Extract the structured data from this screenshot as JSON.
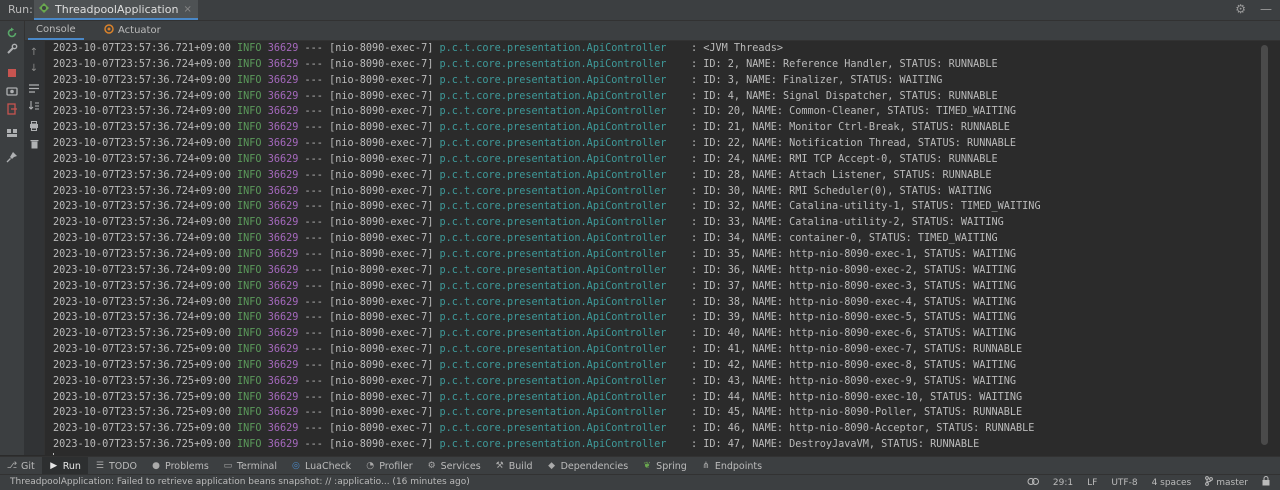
{
  "run_bar": {
    "label": "Run:",
    "tab": "ThreadpoolApplication",
    "close": "×"
  },
  "sub_tabs": {
    "console": "Console",
    "actuator": "Actuator"
  },
  "log_columns": {
    "level": "INFO",
    "pid": "36629",
    "sep": "---",
    "thread": "[nio-8090-exec-7]",
    "logger": "p.c.t.core.presentation.ApiController"
  },
  "log_lines": [
    {
      "ts": "2023-10-07T23:57:36.721+09:00",
      "msg": ": <JVM Threads>"
    },
    {
      "ts": "2023-10-07T23:57:36.724+09:00",
      "msg": ": ID: 2, NAME: Reference Handler, STATUS: RUNNABLE"
    },
    {
      "ts": "2023-10-07T23:57:36.724+09:00",
      "msg": ": ID: 3, NAME: Finalizer, STATUS: WAITING"
    },
    {
      "ts": "2023-10-07T23:57:36.724+09:00",
      "msg": ": ID: 4, NAME: Signal Dispatcher, STATUS: RUNNABLE"
    },
    {
      "ts": "2023-10-07T23:57:36.724+09:00",
      "msg": ": ID: 20, NAME: Common-Cleaner, STATUS: TIMED_WAITING"
    },
    {
      "ts": "2023-10-07T23:57:36.724+09:00",
      "msg": ": ID: 21, NAME: Monitor Ctrl-Break, STATUS: RUNNABLE"
    },
    {
      "ts": "2023-10-07T23:57:36.724+09:00",
      "msg": ": ID: 22, NAME: Notification Thread, STATUS: RUNNABLE"
    },
    {
      "ts": "2023-10-07T23:57:36.724+09:00",
      "msg": ": ID: 24, NAME: RMI TCP Accept-0, STATUS: RUNNABLE"
    },
    {
      "ts": "2023-10-07T23:57:36.724+09:00",
      "msg": ": ID: 28, NAME: Attach Listener, STATUS: RUNNABLE"
    },
    {
      "ts": "2023-10-07T23:57:36.724+09:00",
      "msg": ": ID: 30, NAME: RMI Scheduler(0), STATUS: WAITING"
    },
    {
      "ts": "2023-10-07T23:57:36.724+09:00",
      "msg": ": ID: 32, NAME: Catalina-utility-1, STATUS: TIMED_WAITING"
    },
    {
      "ts": "2023-10-07T23:57:36.724+09:00",
      "msg": ": ID: 33, NAME: Catalina-utility-2, STATUS: WAITING"
    },
    {
      "ts": "2023-10-07T23:57:36.724+09:00",
      "msg": ": ID: 34, NAME: container-0, STATUS: TIMED_WAITING"
    },
    {
      "ts": "2023-10-07T23:57:36.724+09:00",
      "msg": ": ID: 35, NAME: http-nio-8090-exec-1, STATUS: WAITING"
    },
    {
      "ts": "2023-10-07T23:57:36.724+09:00",
      "msg": ": ID: 36, NAME: http-nio-8090-exec-2, STATUS: WAITING"
    },
    {
      "ts": "2023-10-07T23:57:36.724+09:00",
      "msg": ": ID: 37, NAME: http-nio-8090-exec-3, STATUS: WAITING"
    },
    {
      "ts": "2023-10-07T23:57:36.724+09:00",
      "msg": ": ID: 38, NAME: http-nio-8090-exec-4, STATUS: WAITING"
    },
    {
      "ts": "2023-10-07T23:57:36.724+09:00",
      "msg": ": ID: 39, NAME: http-nio-8090-exec-5, STATUS: WAITING"
    },
    {
      "ts": "2023-10-07T23:57:36.725+09:00",
      "msg": ": ID: 40, NAME: http-nio-8090-exec-6, STATUS: WAITING"
    },
    {
      "ts": "2023-10-07T23:57:36.725+09:00",
      "msg": ": ID: 41, NAME: http-nio-8090-exec-7, STATUS: RUNNABLE"
    },
    {
      "ts": "2023-10-07T23:57:36.725+09:00",
      "msg": ": ID: 42, NAME: http-nio-8090-exec-8, STATUS: WAITING"
    },
    {
      "ts": "2023-10-07T23:57:36.725+09:00",
      "msg": ": ID: 43, NAME: http-nio-8090-exec-9, STATUS: WAITING"
    },
    {
      "ts": "2023-10-07T23:57:36.725+09:00",
      "msg": ": ID: 44, NAME: http-nio-8090-exec-10, STATUS: WAITING"
    },
    {
      "ts": "2023-10-07T23:57:36.725+09:00",
      "msg": ": ID: 45, NAME: http-nio-8090-Poller, STATUS: RUNNABLE"
    },
    {
      "ts": "2023-10-07T23:57:36.725+09:00",
      "msg": ": ID: 46, NAME: http-nio-8090-Acceptor, STATUS: RUNNABLE"
    },
    {
      "ts": "2023-10-07T23:57:36.725+09:00",
      "msg": ": ID: 47, NAME: DestroyJavaVM, STATUS: RUNNABLE"
    }
  ],
  "tool_windows": [
    "Git",
    "Run",
    "TODO",
    "Problems",
    "Terminal",
    "LuaCheck",
    "Profiler",
    "Services",
    "Build",
    "Dependencies",
    "Spring",
    "Endpoints"
  ],
  "status_bar": {
    "message": "ThreadpoolApplication: Failed to retrieve application beans snapshot: // :applicatio... (16 minutes ago)",
    "position": "29:1",
    "line_sep": "LF",
    "encoding": "UTF-8",
    "indent": "4 spaces",
    "branch": "master"
  },
  "colors": {
    "accent": "#4a88c7",
    "info": "#5b9a5b",
    "pid": "#a569bd",
    "logger": "#3e9a9a",
    "stop": "#c75450",
    "rerun": "#59a869"
  }
}
